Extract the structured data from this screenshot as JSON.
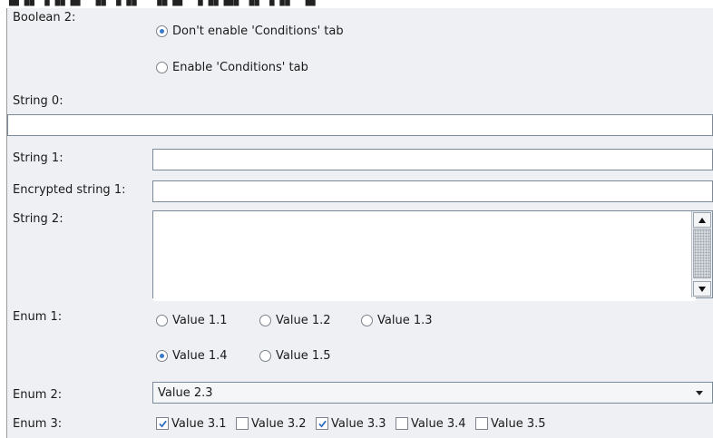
{
  "form": {
    "boolean2": {
      "label": "Boolean 2:",
      "options": [
        {
          "label": "Don't enable 'Conditions' tab",
          "checked": true
        },
        {
          "label": "Enable 'Conditions' tab",
          "checked": false
        }
      ]
    },
    "string0": {
      "label": "String 0:",
      "value": ""
    },
    "string1": {
      "label": "String 1:",
      "value": ""
    },
    "encrypted1": {
      "label": "Encrypted string 1:",
      "value": ""
    },
    "string2": {
      "label": "String 2:",
      "value": ""
    },
    "enum1": {
      "label": "Enum 1:",
      "options": [
        {
          "label": "Value 1.1",
          "checked": false
        },
        {
          "label": "Value 1.2",
          "checked": false
        },
        {
          "label": "Value 1.3",
          "checked": false
        },
        {
          "label": "Value 1.4",
          "checked": true
        },
        {
          "label": "Value 1.5",
          "checked": false
        }
      ]
    },
    "enum2": {
      "label": "Enum 2:",
      "selected": "Value 2.3"
    },
    "enum3": {
      "label": "Enum 3:",
      "options": [
        {
          "label": "Value 3.1",
          "checked": true
        },
        {
          "label": "Value 3.2",
          "checked": false
        },
        {
          "label": "Value 3.3",
          "checked": true
        },
        {
          "label": "Value 3.4",
          "checked": false
        },
        {
          "label": "Value 3.5",
          "checked": false
        }
      ]
    }
  },
  "colors": {
    "accent": "#3a78c8",
    "panel": "#eef0f4",
    "border": "#7a8a99"
  }
}
